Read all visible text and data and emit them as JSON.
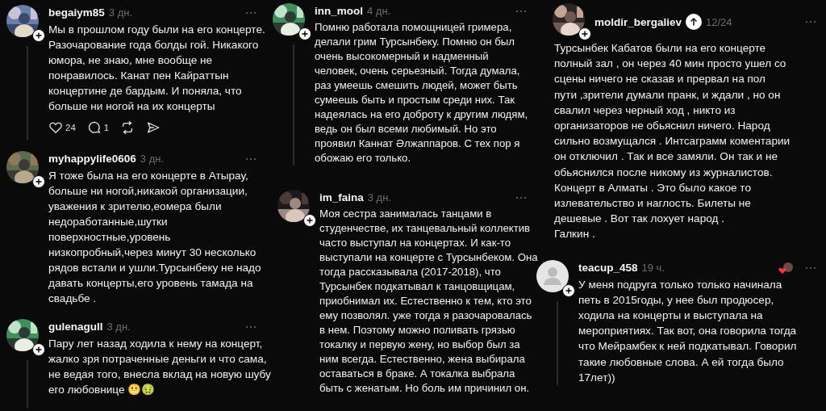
{
  "columns": [
    {
      "comments": [
        {
          "avatar": {
            "kind": "picture"
          },
          "username": "begaiym85",
          "time": "3 дн.",
          "text_below_avatar": false,
          "thread_line": true,
          "lines": [
            "Мы в прошлом году были на его концерте.",
            "Разочарование года болды гой. Никакого",
            "юмора, не знаю, мне вообще не",
            "понравилось. Канат пен Кайраттын",
            "концертине де бардым. И поняла, что",
            "больше ни ногой на их концерты"
          ],
          "actions": {
            "likes": "24",
            "replies": "1"
          }
        },
        {
          "avatar": {
            "kind": "picture"
          },
          "username": "myhappylife0606",
          "time": "3 дн.",
          "text_below_avatar": false,
          "thread_line": false,
          "lines": [
            "Я тоже была на его концерте в Атырау,",
            "больше ни ногой,никакой организации,",
            "уважения к зрителю,еомера были",
            "недоработанные,шутки",
            "поверхностные,уровень",
            "низкопробный,через минут 30  несколько",
            "рядов встали и ушли.Турсынбеку не надо",
            "давать концерты,его уровень  тамада на",
            "свадьбе ."
          ]
        },
        {
          "avatar": {
            "kind": "picture"
          },
          "username": "gulenagull",
          "time": "3 дн.",
          "text_below_avatar": false,
          "thread_line": true,
          "lines": [
            "Пару лет назад ходила к нему на концерт,",
            "жалко зря потраченные деньги и что сама,",
            "не ведая того, внесла вклад на новую шубу",
            "его любовнице 😬🤢"
          ]
        }
      ]
    },
    {
      "comments": [
        {
          "avatar": {
            "kind": "picture"
          },
          "username": "inn_mool",
          "time": "4 дн.",
          "text_below_avatar": false,
          "thread_line": true,
          "lines": [
            "Помню работала помощницей гримера,",
            "делали грим Турсынбеку. Помню он был",
            "очень высокомерный и надменный",
            "человек, очень серьезный. Тогда думала,",
            "раз умеешь смешить людей, может быть",
            "сумеешь быть и простым среди них. Так",
            "надеялась на его доброту к другим людям,",
            "ведь он был всеми любимый. Но это",
            "проявил Каннат Әлжаппаров. С тех пор я",
            "обожаю его только."
          ]
        },
        {
          "avatar": {
            "kind": "picture"
          },
          "username": "im_faina",
          "time": "3 дн.",
          "text_below_avatar": false,
          "thread_line": false,
          "lines": [
            "Моя сестра занималась танцами в",
            "студенчестве, их танцевальный коллектив",
            "часто выступал на концертах. И как-то",
            "выступали на концерте с Турсынбеком. Она",
            "тогда рассказывала (2017-2018), что",
            "Турсынбек подкатывал к танцовщицам,",
            "приобнимал их. Естественно к тем, кто это",
            "ему позволял. уже тогда я разочаровалась",
            "в нем. Поэтому можно поливать грязью",
            "токалку и первую жену, но выбор был за",
            "ним всегда. Естественно, жена выбирала",
            "оставаться в браке. А токалка выбрала",
            "быть с женатым. Но боль им причинил он."
          ]
        }
      ]
    },
    {
      "comments": [
        {
          "avatar": {
            "kind": "picture"
          },
          "username": "moldir_bergaliev",
          "time": "12/24",
          "text_below_avatar": true,
          "thread_line": false,
          "scroll_up": true,
          "lines": [
            "Турсынбек Кабатов были на его концерте",
            "полный зал , он через 40 мин просто ушел со",
            "сцены ничего не сказав и прервал на пол",
            "пути ,зрители думали пранк, и ждали , но он",
            "свалил через черный ход , никто из",
            "организаторов не обьяснил ничего. Народ",
            "сильно возмущался . Интсаграмм коментарии",
            "он отключил . Так и все замяли. Он так и не",
            "обьяснился после никому из журналистов.",
            "Концерт в Алматы . Это было какое то",
            "излевательство и наглость. Билеты не",
            "дешевые . Вот так лохует народ .",
            "Галкин ."
          ]
        },
        {
          "avatar": {
            "kind": "default"
          },
          "username": "teacup_458",
          "time": "19 ч.",
          "text_below_avatar": false,
          "thread_line": true,
          "liked_by_author": true,
          "lines": [
            "У меня подруга только только начинала",
            "петь в 2015годы, у нее был продюсер,",
            "ходила на концерты и выступала на",
            "мероприятиях. Так вот, она говорила тогда",
            "что Мейрамбек к ней подкатывал. Говорил",
            "такие любовные слова. А ей тогда было",
            "17лет))"
          ]
        }
      ]
    }
  ]
}
